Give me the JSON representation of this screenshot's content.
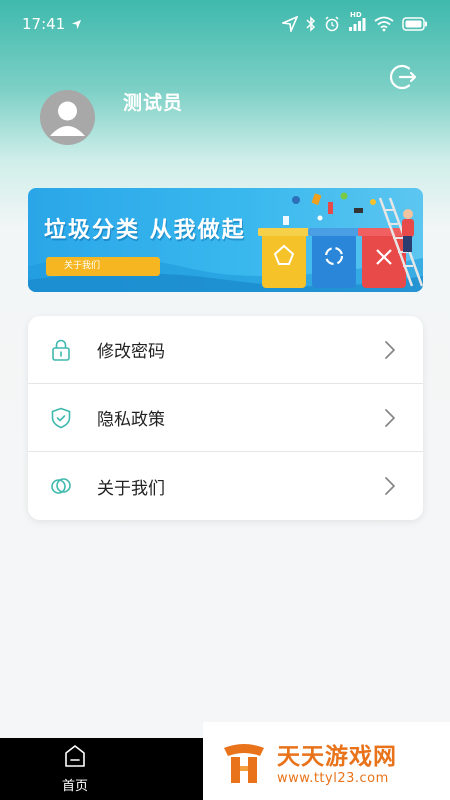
{
  "status_bar": {
    "time": "17:41",
    "hd_label": "HD",
    "icons": [
      "location-arrow-icon",
      "bluetooth-icon",
      "alarm-icon",
      "signal-icon",
      "wifi-icon",
      "battery-icon"
    ]
  },
  "profile": {
    "username": "测试员",
    "avatar_icon": "user-avatar-icon",
    "logout_icon": "logout-icon"
  },
  "banner": {
    "title": "垃圾分类 从我做起",
    "button_label": "关于我们",
    "colors": {
      "background": "#2aa6e8",
      "button": "#f5b621",
      "bin_yellow": "#f5c22a",
      "bin_blue": "#2a86d8",
      "bin_red": "#e84a4a"
    }
  },
  "menu": {
    "items": [
      {
        "label": "修改密码",
        "icon": "lock-icon"
      },
      {
        "label": "隐私政策",
        "icon": "shield-check-icon"
      },
      {
        "label": "关于我们",
        "icon": "overlap-circles-icon"
      }
    ],
    "accent_color": "#3fb9ad"
  },
  "bottom_nav": {
    "home_label": "首页",
    "home_icon": "home-icon"
  },
  "watermark": {
    "title": "天天游戏网",
    "url": "www.ttyl23.com",
    "color": "#e8731a"
  }
}
